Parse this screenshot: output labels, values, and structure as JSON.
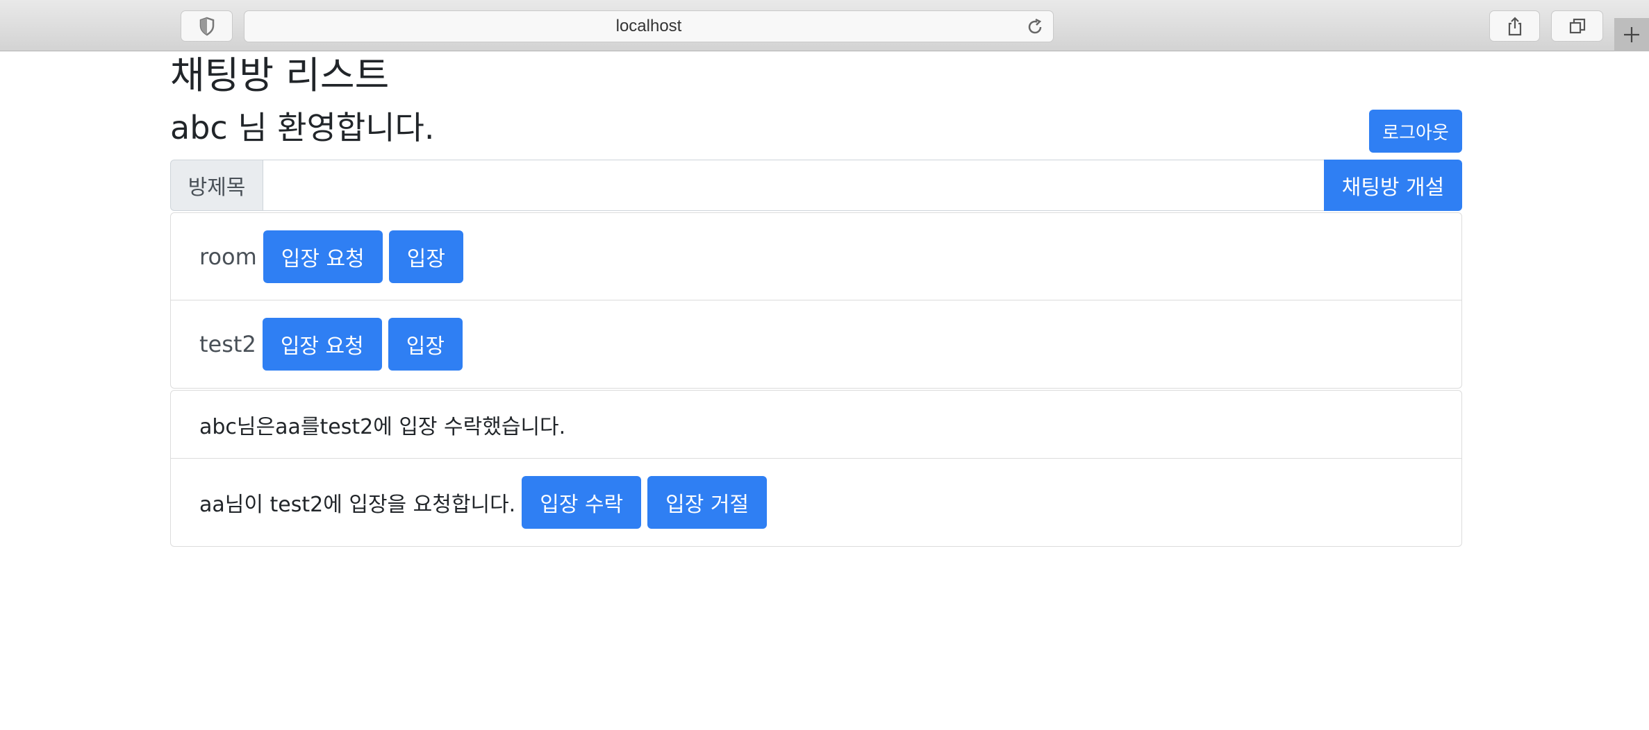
{
  "browser": {
    "url": "localhost",
    "icons": [
      "shield-icon",
      "reload-icon",
      "share-icon",
      "tabs-icon",
      "plus-icon"
    ]
  },
  "page": {
    "title": "채팅방 리스트",
    "welcome": "abc 님 환영합니다.",
    "logout_label": "로그아웃"
  },
  "create_room": {
    "label": "방제목",
    "value": "",
    "placeholder": "",
    "button_label": "채팅방 개설"
  },
  "rooms": [
    {
      "name": "room",
      "request_label": "입장 요청",
      "enter_label": "입장"
    },
    {
      "name": "test2",
      "request_label": "입장 요청",
      "enter_label": "입장"
    }
  ],
  "notices": [
    {
      "text": "abc님은aa를test2에 입장 수락했습니다."
    },
    {
      "text": "aa님이 test2에 입장을 요청합니다.",
      "accept_label": "입장 수락",
      "reject_label": "입장 거절"
    }
  ],
  "colors": {
    "primary": "#2f7ff3",
    "border": "#dcdcdc",
    "chrome": "#d9d9d9"
  }
}
